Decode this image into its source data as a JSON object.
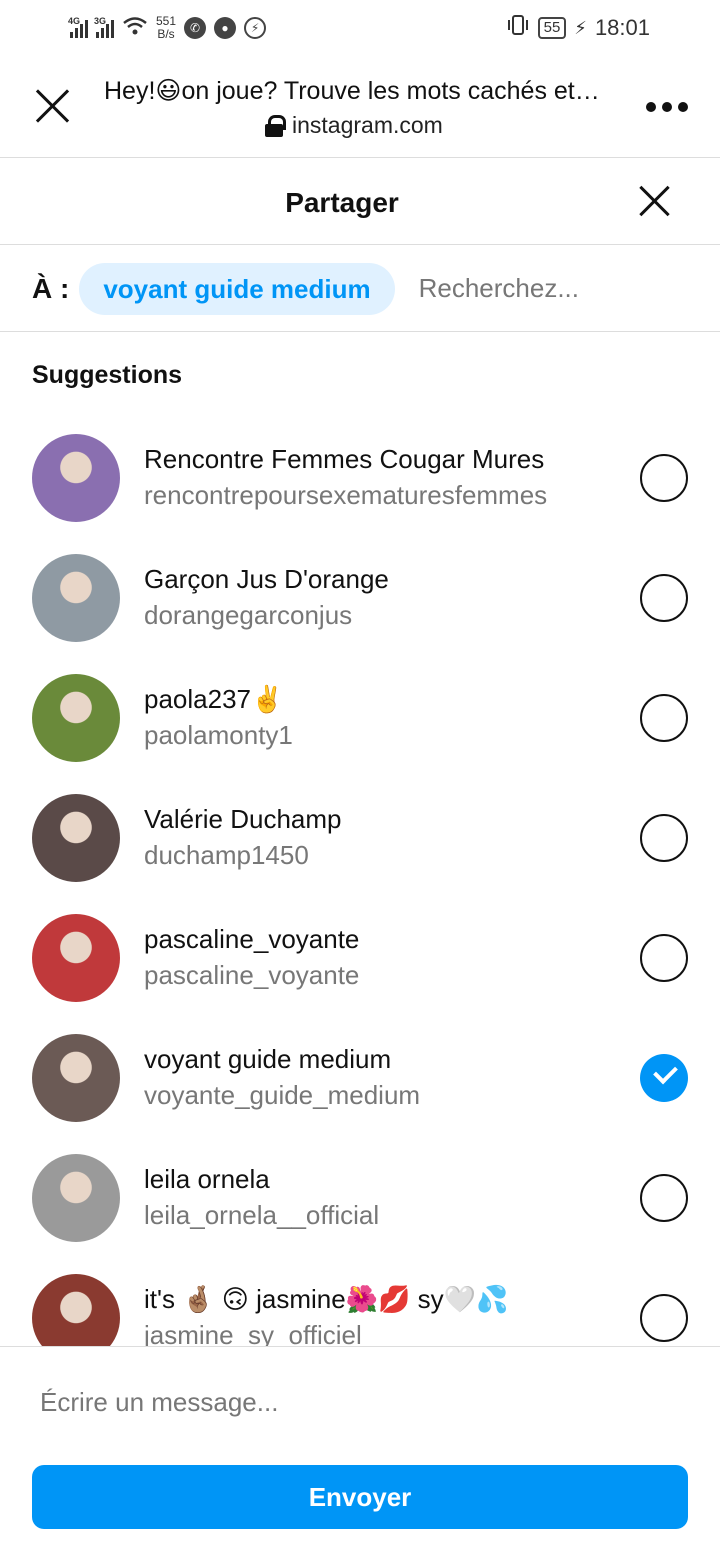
{
  "status_bar": {
    "net1": "4G",
    "net2": "3G",
    "speed_value": "551",
    "speed_unit": "B/s",
    "battery": "55",
    "time": "18:01"
  },
  "browser": {
    "title": "Hey!😃on joue? Trouve les mots cachés et…",
    "url": "instagram.com"
  },
  "share": {
    "title": "Partager",
    "to_label": "À :",
    "chip": "voyant guide medium",
    "search_placeholder": "Recherchez..."
  },
  "suggestions": {
    "title": "Suggestions",
    "items": [
      {
        "name": "Rencontre Femmes Cougar Mures",
        "handle": "rencontrepoursexematuresfemmes",
        "checked": false,
        "avatar_color": "#8a6fb0"
      },
      {
        "name": "Garçon Jus D'orange",
        "handle": "dorangegarconjus",
        "checked": false,
        "avatar_color": "#8f9aa3"
      },
      {
        "name": "paola237✌️",
        "handle": "paolamonty1",
        "checked": false,
        "avatar_color": "#6a8a3a"
      },
      {
        "name": "Valérie Duchamp",
        "handle": "duchamp1450",
        "checked": false,
        "avatar_color": "#5a4a48"
      },
      {
        "name": "pascaline_voyante",
        "handle": "pascaline_voyante",
        "checked": false,
        "avatar_color": "#c0393b"
      },
      {
        "name": "voyant guide medium",
        "handle": "voyante_guide_medium",
        "checked": true,
        "avatar_color": "#6b5a55"
      },
      {
        "name": "leila ornela",
        "handle": "leila_ornela__official",
        "checked": false,
        "avatar_color": "#9a9a9a"
      },
      {
        "name": "it's 🤞🏽 🙃 jasmine🌺💋 sy🤍💦",
        "handle": "jasmine_sy_officiel_",
        "checked": false,
        "avatar_color": "#8a3a30"
      }
    ]
  },
  "footer": {
    "message_placeholder": "Écrire un message...",
    "send_label": "Envoyer"
  }
}
